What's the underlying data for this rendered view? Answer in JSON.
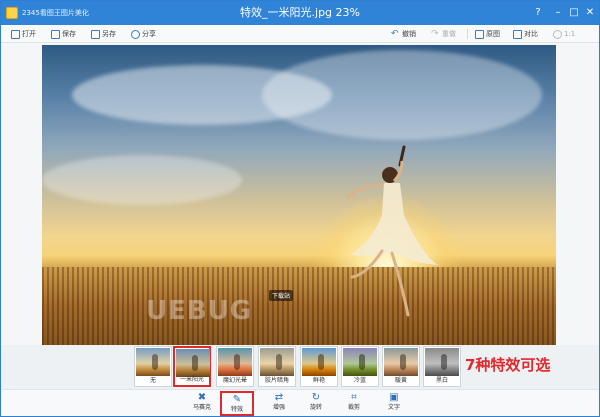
{
  "titlebar": {
    "app_name": "2345看图王图片美化",
    "title": "特效_一米阳光.jpg  23%",
    "controls": [
      {
        "name": "help",
        "glyph": "?"
      },
      {
        "name": "minimize",
        "glyph": "–"
      },
      {
        "name": "maximize",
        "glyph": "□"
      },
      {
        "name": "close",
        "glyph": "✕"
      }
    ]
  },
  "toolbar": {
    "open": "打开",
    "save": "保存",
    "save_as": "另存",
    "share": "分享",
    "undo": "撤销",
    "redo": "重做",
    "original": "原图",
    "compare": "对比",
    "ratio": "1:1"
  },
  "watermark": {
    "text": "UEBUG",
    "tag": "下载站"
  },
  "filters": {
    "items": [
      "无",
      "一米阳光",
      "魔幻光晕",
      "胶片暗角",
      "鲜艳",
      "冷蓝",
      "暖黄",
      "黑白"
    ],
    "selected": "一米阳光"
  },
  "promo": "7种特效可选",
  "bottombar": {
    "mosaic": "马赛克",
    "effects": "特效",
    "enhance": "增强",
    "rotate": "旋转",
    "crop": "裁剪",
    "text": "文字"
  },
  "colors": {
    "title_bar": "#2f84d8",
    "highlight": "#e0292c",
    "icon": "#2f6fb8"
  }
}
